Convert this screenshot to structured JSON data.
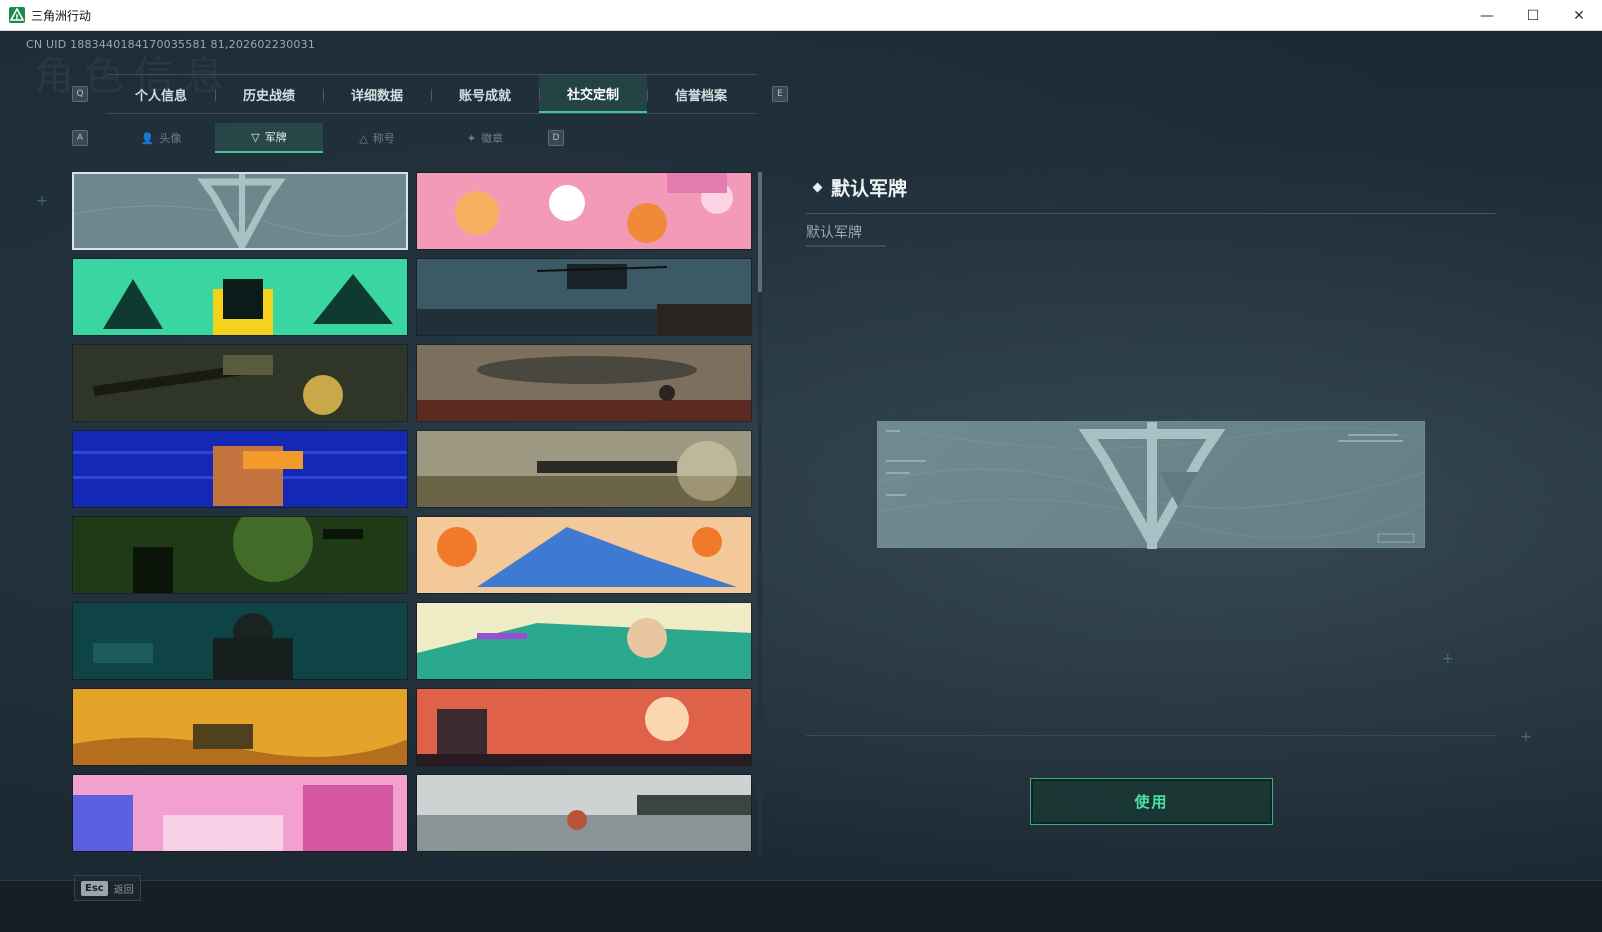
{
  "window": {
    "title": "三角洲行动",
    "min_glyph": "—",
    "max_glyph": "☐",
    "close_glyph": "✕"
  },
  "header": {
    "uid": "CN UID 1883440184170035581 81,202602230031",
    "watermark": "角色信息"
  },
  "main_tabs": {
    "key_left": "Q",
    "key_right": "E",
    "items": [
      {
        "label": "个人信息"
      },
      {
        "label": "历史战绩"
      },
      {
        "label": "详细数据"
      },
      {
        "label": "账号成就"
      },
      {
        "label": "社交定制",
        "active": true
      },
      {
        "label": "信誉档案"
      }
    ]
  },
  "sub_tabs": {
    "key_left": "A",
    "key_right": "D",
    "items": [
      {
        "label": "头像",
        "icon": "person-icon"
      },
      {
        "label": "军牌",
        "icon": "dogtag-icon",
        "active": true
      },
      {
        "label": "称号",
        "icon": "title-icon"
      },
      {
        "label": "徽章",
        "icon": "badge-icon"
      }
    ]
  },
  "cards": [
    {
      "theme": "default-tag",
      "selected": true
    },
    {
      "theme": "pink-cats"
    },
    {
      "theme": "green-hands"
    },
    {
      "theme": "helicopter-storm"
    },
    {
      "theme": "weapons-table"
    },
    {
      "theme": "bomber-poppies"
    },
    {
      "theme": "blue-glitch-vr"
    },
    {
      "theme": "sniper-desert"
    },
    {
      "theme": "night-vision"
    },
    {
      "theme": "orange-blue-art"
    },
    {
      "theme": "teal-gym"
    },
    {
      "theme": "music-headphones"
    },
    {
      "theme": "desert-surreal"
    },
    {
      "theme": "sunset-girl"
    },
    {
      "theme": "pink-city"
    },
    {
      "theme": "beach-sunset"
    }
  ],
  "detail": {
    "title": "默认军牌",
    "subtitle": "默认军牌"
  },
  "actions": {
    "use_label": "使用",
    "esc_key": "Esc",
    "esc_label": "返回"
  },
  "colors": {
    "accent": "#3ec792",
    "button_text": "#4be2a4",
    "background": "#1c2a34"
  }
}
